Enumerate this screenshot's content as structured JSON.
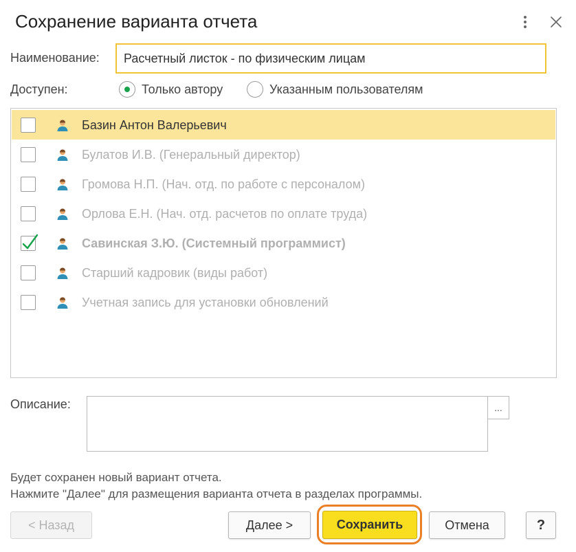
{
  "window": {
    "title": "Сохранение варианта отчета",
    "more_icon": "more-vertical-icon",
    "close_icon": "close-icon"
  },
  "form": {
    "name_label": "Наименование:",
    "name_value": "Расчетный листок - по физическим лицам",
    "access_label": "Доступен:",
    "access_options": [
      {
        "label": "Только автору",
        "selected": true
      },
      {
        "label": "Указанным пользователям",
        "selected": false
      }
    ],
    "description_label": "Описание:",
    "description_value": "",
    "description_button": "..."
  },
  "users": [
    {
      "name": "Базин Антон Валерьевич",
      "checked": false,
      "selected": true,
      "bold": false
    },
    {
      "name": "Булатов И.В. (Генеральный директор)",
      "checked": false,
      "selected": false,
      "bold": false
    },
    {
      "name": "Громова Н.П. (Нач. отд. по работе с персоналом)",
      "checked": false,
      "selected": false,
      "bold": false
    },
    {
      "name": "Орлова Е.Н. (Нач. отд. расчетов по оплате труда)",
      "checked": false,
      "selected": false,
      "bold": false
    },
    {
      "name": "Савинская З.Ю. (Системный программист)",
      "checked": true,
      "selected": false,
      "bold": true
    },
    {
      "name": "Старший кадровик (виды работ)",
      "checked": false,
      "selected": false,
      "bold": false
    },
    {
      "name": "Учетная запись для установки обновлений",
      "checked": false,
      "selected": false,
      "bold": false
    }
  ],
  "info": {
    "line1": "Будет сохранен новый вариант отчета.",
    "line2": "Нажмите \"Далее\" для размещения варианта отчета в разделах программы."
  },
  "buttons": {
    "back": "< Назад",
    "next": "Далее >",
    "save": "Сохранить",
    "cancel": "Отмена",
    "help": "?"
  },
  "colors": {
    "accent_yellow": "#f8de1f",
    "selection": "#fbe59a",
    "input_border": "#f0c435",
    "check_green": "#16a34a",
    "highlight_ring": "#ea7f26"
  }
}
